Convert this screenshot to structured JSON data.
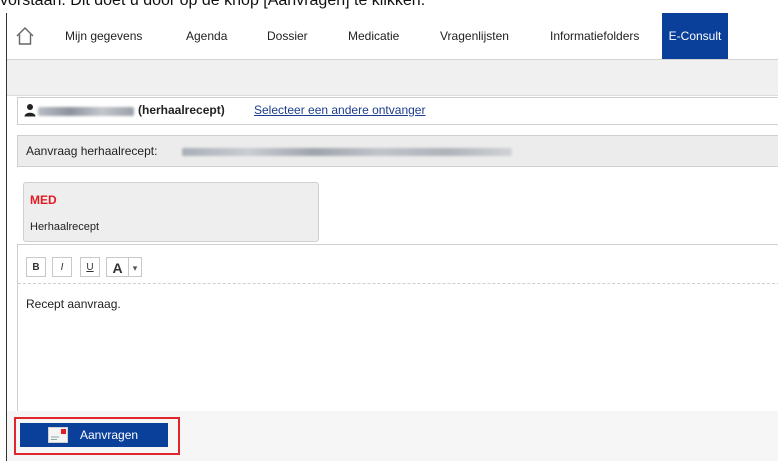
{
  "caption": "vorstaan. Dit doet u door op de knop [Aanvragen] te klikken.",
  "nav": {
    "home_icon": "home-icon",
    "items": [
      {
        "label": "Mijn gegevens"
      },
      {
        "label": "Agenda"
      },
      {
        "label": "Dossier"
      },
      {
        "label": "Medicatie"
      },
      {
        "label": "Vragenlijsten"
      },
      {
        "label": "Informatiefolders"
      },
      {
        "label": "E-Consult",
        "active": true
      }
    ]
  },
  "recipient": {
    "icon": "person-icon",
    "type_label": "(herhaalrecept)",
    "change_link": "Selecteer een andere ontvanger"
  },
  "request": {
    "label": "Aanvraag herhaalrecept:"
  },
  "med": {
    "code": "MED",
    "name": "Herhaalrecept"
  },
  "editor": {
    "toolbar": {
      "bold": "B",
      "italic": "I",
      "underline": "U",
      "color": "A",
      "color_dropdown": "▾"
    },
    "text": "Recept aanvraag."
  },
  "submit": {
    "icon": "mail-icon",
    "label": "Aanvragen"
  },
  "colors": {
    "primary": "#0a3f9a",
    "med_code": "#e31b23",
    "highlight": "#e0262b",
    "link": "#1a3c8c"
  }
}
